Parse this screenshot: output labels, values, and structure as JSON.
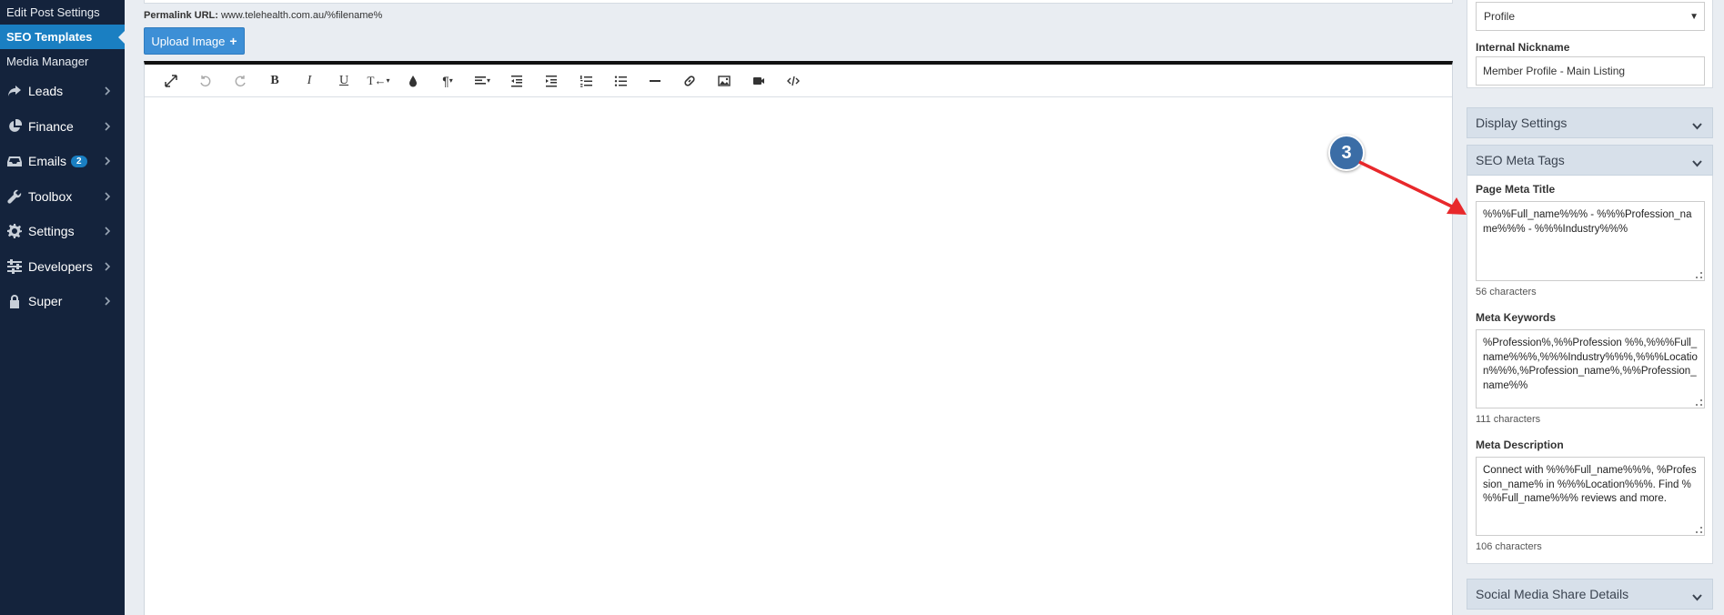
{
  "sidebar": {
    "sub_items": [
      {
        "label": "Edit Post Settings"
      },
      {
        "label": "SEO Templates"
      },
      {
        "label": "Media Manager"
      }
    ],
    "nav": [
      {
        "label": "Leads",
        "icon": "share-arrow-icon"
      },
      {
        "label": "Finance",
        "icon": "pie-chart-icon"
      },
      {
        "label": "Emails",
        "icon": "inbox-icon",
        "badge": "2"
      },
      {
        "label": "Toolbox",
        "icon": "wrench-icon"
      },
      {
        "label": "Settings",
        "icon": "gear-icon"
      },
      {
        "label": "Developers",
        "icon": "sliders-icon"
      },
      {
        "label": "Super",
        "icon": "lock-icon"
      }
    ]
  },
  "main": {
    "permalink_label": "Permalink URL:",
    "permalink_value": "www.telehealth.com.au/%filename%",
    "upload_button": "Upload Image",
    "toolbar": [
      "expand",
      "undo",
      "redo",
      "bold",
      "italic",
      "underline",
      "text-size",
      "color",
      "paragraph",
      "align",
      "outdent",
      "indent",
      "ordered-list",
      "unordered-list",
      "horizontal-rule",
      "link",
      "image",
      "video",
      "code"
    ]
  },
  "right_panel": {
    "profile_select": "Profile",
    "internal_nickname_label": "Internal Nickname",
    "internal_nickname_value": "Member Profile - Main Listing",
    "display_settings": "Display Settings",
    "seo_meta_tags": "SEO Meta Tags",
    "page_meta_title_label": "Page Meta Title",
    "page_meta_title_value": "%%%Full_name%%% - %%%Profession_name%%% - %%%Industry%%%",
    "page_meta_title_count": "56 characters",
    "meta_keywords_label": "Meta Keywords",
    "meta_keywords_value": "%Profession%,%%Profession %%,%%%Full_name%%%,%%%Industry%%%,%%%Location%%%,%Profession_name%,%%Profession_name%%",
    "meta_keywords_count": "111 characters",
    "meta_description_label": "Meta Description",
    "meta_description_value": "Connect with %%%Full_name%%%, %Profession_name% in %%%Location%%%. Find %%%Full_name%%% reviews and more.",
    "meta_description_count": "106 characters",
    "social_media": "Social Media Share Details"
  },
  "annotation": {
    "number": "3",
    "color": "#e8282b"
  }
}
